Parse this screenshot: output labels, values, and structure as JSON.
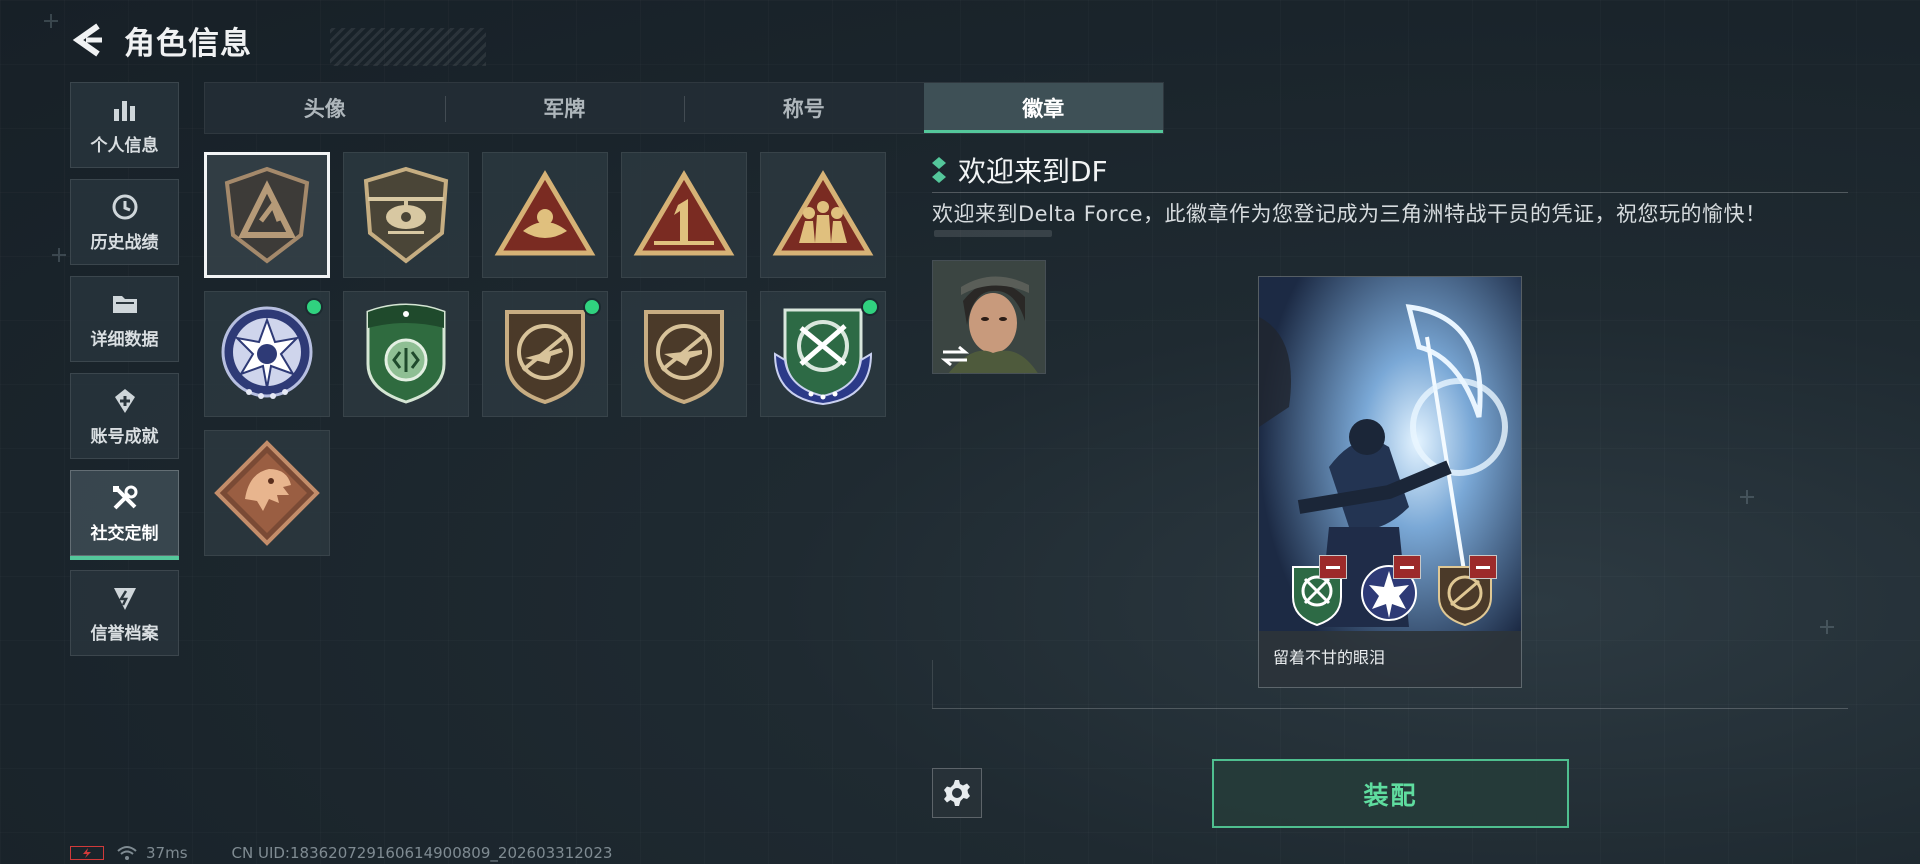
{
  "header": {
    "title": "角色信息"
  },
  "side_nav": {
    "items": [
      {
        "label": "个人信息",
        "icon": "bar-chart-icon"
      },
      {
        "label": "历史战绩",
        "icon": "history-clock-icon"
      },
      {
        "label": "详细数据",
        "icon": "folder-icon"
      },
      {
        "label": "账号成就",
        "icon": "achievement-icon"
      },
      {
        "label": "社交定制",
        "icon": "tools-icon",
        "active": true
      },
      {
        "label": "信誉档案",
        "icon": "shield-bolt-icon"
      }
    ]
  },
  "tabs": [
    {
      "label": "头像"
    },
    {
      "label": "军牌"
    },
    {
      "label": "称号"
    },
    {
      "label": "徽章",
      "active": true
    }
  ],
  "badges": [
    {
      "name": "delta-triangle-badge",
      "selected": true,
      "new": false
    },
    {
      "name": "helicopter-badge",
      "new": false
    },
    {
      "name": "hand-triangle-badge",
      "new": false
    },
    {
      "name": "number-one-badge",
      "new": false
    },
    {
      "name": "squad-triangle-badge",
      "new": false
    },
    {
      "name": "star-skull-badge",
      "new": true
    },
    {
      "name": "green-shield-badge",
      "new": false
    },
    {
      "name": "rifle-shield-badge",
      "new": true
    },
    {
      "name": "rifle-shield-badge-2",
      "new": false
    },
    {
      "name": "crossed-knives-badge",
      "new": true
    },
    {
      "name": "dragon-diamond-badge",
      "new": false
    }
  ],
  "detail": {
    "title": "欢迎来到DF",
    "description": "欢迎来到Delta Force，此徽章作为您登记成为三角洲特战干员的凭证，祝您玩的愉快！"
  },
  "preview": {
    "caption": "留着不甘的眼泪"
  },
  "actions": {
    "equip_label": "装配"
  },
  "status": {
    "ping": "37ms",
    "uid": "CN UID:18362072916061490080​9_202603312023"
  },
  "colors": {
    "accent": "#54c79b",
    "new_dot": "#30d27f",
    "remove": "#9c2a2a"
  }
}
